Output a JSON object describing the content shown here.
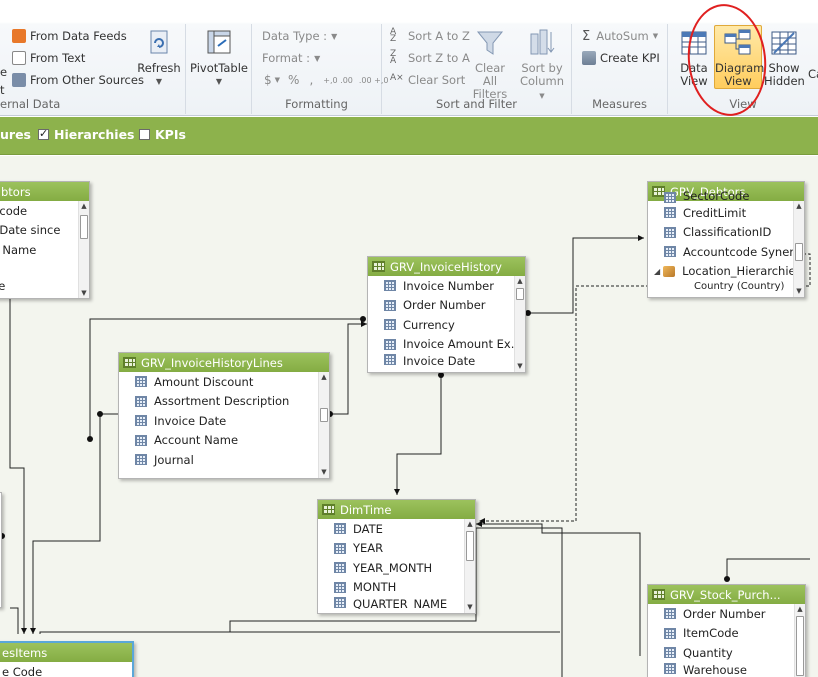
{
  "ribbon": {
    "external_data": {
      "group_label": "ernal Data",
      "left_cut_1": "e",
      "left_cut_2": "t",
      "from_data_feeds": "From Data Feeds",
      "from_text": "From Text",
      "from_other_sources": "From Other Sources",
      "refresh": "Refresh"
    },
    "pivottable": {
      "label": "PivotTable"
    },
    "formatting": {
      "group_label": "Formatting",
      "data_type": "Data Type :",
      "format": "Format :",
      "currency": "$",
      "percent": "%",
      "comma": ",",
      "inc_decimal": "+,0 .00",
      "dec_decimal": ".00 +,0"
    },
    "sort_filter": {
      "group_label": "Sort and Filter",
      "sort_az": "Sort A to Z",
      "sort_za": "Sort Z to A",
      "clear_sort": "Clear Sort",
      "clear_all_filters_1": "Clear All",
      "clear_all_filters_2": "Filters",
      "sort_by_column_1": "Sort by",
      "sort_by_column_2": "Column"
    },
    "measures": {
      "group_label": "Measures",
      "autosum": "AutoSum",
      "create_kpi": "Create KPI"
    },
    "view": {
      "group_label": "View",
      "data_view_1": "Data",
      "data_view_2": "View",
      "diagram_view_1": "Diagram",
      "diagram_view_2": "View",
      "show_hidden_1": "Show",
      "show_hidden_2": "Hidden",
      "cut_label": "Ca"
    }
  },
  "toolbar": {
    "measures_cut": "ures",
    "hierarchies": "Hierarchies",
    "hierarchies_checked": true,
    "kpis": "KPIs",
    "kpis_checked": false
  },
  "tables": {
    "debtors_left": {
      "title": "btors",
      "rows": [
        "r code",
        "r Date since",
        "ıt Name",
        "",
        "de"
      ]
    },
    "invoice_history": {
      "title": "GRV_InvoiceHistory",
      "rows": [
        "Invoice Number",
        "Order Number",
        "Currency",
        "Invoice Amount Ex...",
        "Invoice Date"
      ]
    },
    "invoice_history_lines": {
      "title": "GRV_InvoiceHistoryLines",
      "rows": [
        "Amount Discount",
        "Assortment Description",
        "Invoice Date",
        "Account Name",
        "Journal"
      ]
    },
    "debtors": {
      "title": "GRV_Debtors",
      "rows": [
        "SectorCode",
        "CreditLimit",
        "ClassificationID",
        "Accountcode Syner...",
        "Location_Hierarchie",
        "Country (Country)"
      ]
    },
    "dimtime": {
      "title": "DimTime",
      "rows": [
        "DATE",
        "YEAR",
        "YEAR_MONTH",
        "MONTH",
        "QUARTER_NAME"
      ]
    },
    "stock_purch": {
      "title": "GRV_Stock_Purch...",
      "rows": [
        "Order Number",
        "ItemCode",
        "Quantity",
        "Warehouse"
      ]
    },
    "sales_items": {
      "title": "esItems",
      "rows": [
        "e Code"
      ]
    }
  },
  "colors": {
    "accent_green": "#8db24c",
    "annotation_red": "#e02020",
    "selected_blue": "#5aa7d9"
  }
}
